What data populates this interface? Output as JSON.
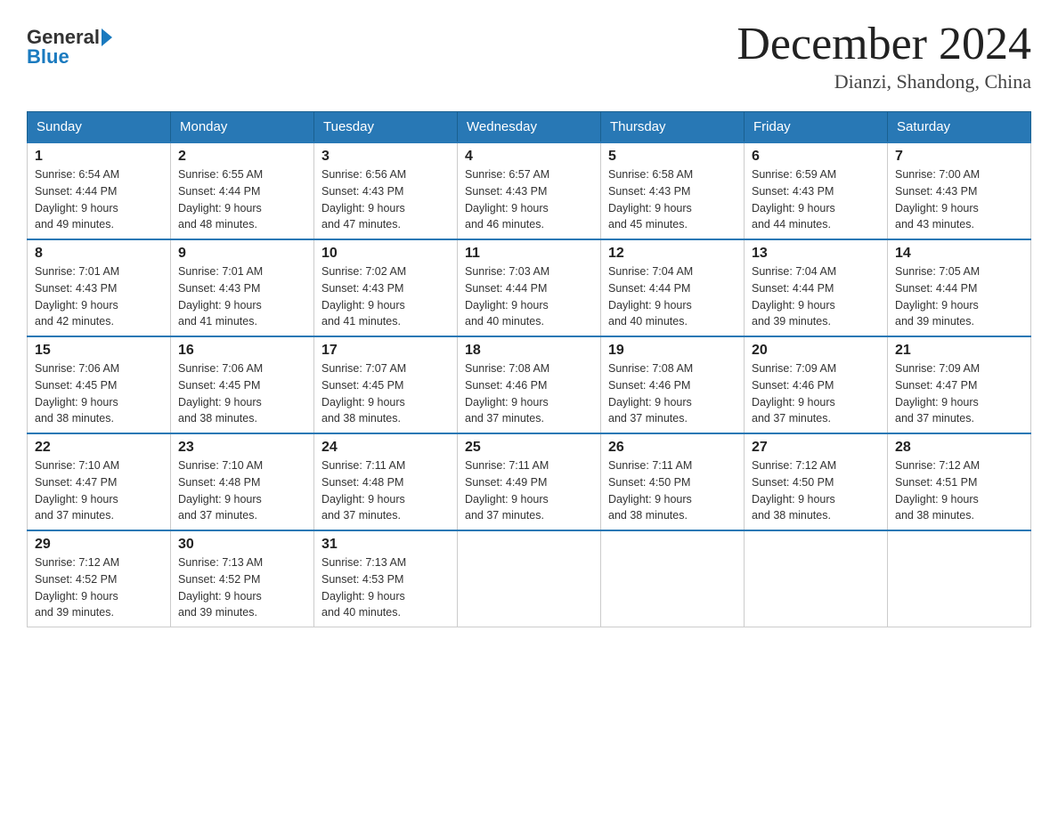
{
  "header": {
    "logo_text_general": "General",
    "logo_text_blue": "Blue",
    "month_title": "December 2024",
    "location": "Dianzi, Shandong, China"
  },
  "weekdays": [
    "Sunday",
    "Monday",
    "Tuesday",
    "Wednesday",
    "Thursday",
    "Friday",
    "Saturday"
  ],
  "weeks": [
    [
      {
        "day": "1",
        "sunrise": "6:54 AM",
        "sunset": "4:44 PM",
        "daylight": "9 hours and 49 minutes."
      },
      {
        "day": "2",
        "sunrise": "6:55 AM",
        "sunset": "4:44 PM",
        "daylight": "9 hours and 48 minutes."
      },
      {
        "day": "3",
        "sunrise": "6:56 AM",
        "sunset": "4:43 PM",
        "daylight": "9 hours and 47 minutes."
      },
      {
        "day": "4",
        "sunrise": "6:57 AM",
        "sunset": "4:43 PM",
        "daylight": "9 hours and 46 minutes."
      },
      {
        "day": "5",
        "sunrise": "6:58 AM",
        "sunset": "4:43 PM",
        "daylight": "9 hours and 45 minutes."
      },
      {
        "day": "6",
        "sunrise": "6:59 AM",
        "sunset": "4:43 PM",
        "daylight": "9 hours and 44 minutes."
      },
      {
        "day": "7",
        "sunrise": "7:00 AM",
        "sunset": "4:43 PM",
        "daylight": "9 hours and 43 minutes."
      }
    ],
    [
      {
        "day": "8",
        "sunrise": "7:01 AM",
        "sunset": "4:43 PM",
        "daylight": "9 hours and 42 minutes."
      },
      {
        "day": "9",
        "sunrise": "7:01 AM",
        "sunset": "4:43 PM",
        "daylight": "9 hours and 41 minutes."
      },
      {
        "day": "10",
        "sunrise": "7:02 AM",
        "sunset": "4:43 PM",
        "daylight": "9 hours and 41 minutes."
      },
      {
        "day": "11",
        "sunrise": "7:03 AM",
        "sunset": "4:44 PM",
        "daylight": "9 hours and 40 minutes."
      },
      {
        "day": "12",
        "sunrise": "7:04 AM",
        "sunset": "4:44 PM",
        "daylight": "9 hours and 40 minutes."
      },
      {
        "day": "13",
        "sunrise": "7:04 AM",
        "sunset": "4:44 PM",
        "daylight": "9 hours and 39 minutes."
      },
      {
        "day": "14",
        "sunrise": "7:05 AM",
        "sunset": "4:44 PM",
        "daylight": "9 hours and 39 minutes."
      }
    ],
    [
      {
        "day": "15",
        "sunrise": "7:06 AM",
        "sunset": "4:45 PM",
        "daylight": "9 hours and 38 minutes."
      },
      {
        "day": "16",
        "sunrise": "7:06 AM",
        "sunset": "4:45 PM",
        "daylight": "9 hours and 38 minutes."
      },
      {
        "day": "17",
        "sunrise": "7:07 AM",
        "sunset": "4:45 PM",
        "daylight": "9 hours and 38 minutes."
      },
      {
        "day": "18",
        "sunrise": "7:08 AM",
        "sunset": "4:46 PM",
        "daylight": "9 hours and 37 minutes."
      },
      {
        "day": "19",
        "sunrise": "7:08 AM",
        "sunset": "4:46 PM",
        "daylight": "9 hours and 37 minutes."
      },
      {
        "day": "20",
        "sunrise": "7:09 AM",
        "sunset": "4:46 PM",
        "daylight": "9 hours and 37 minutes."
      },
      {
        "day": "21",
        "sunrise": "7:09 AM",
        "sunset": "4:47 PM",
        "daylight": "9 hours and 37 minutes."
      }
    ],
    [
      {
        "day": "22",
        "sunrise": "7:10 AM",
        "sunset": "4:47 PM",
        "daylight": "9 hours and 37 minutes."
      },
      {
        "day": "23",
        "sunrise": "7:10 AM",
        "sunset": "4:48 PM",
        "daylight": "9 hours and 37 minutes."
      },
      {
        "day": "24",
        "sunrise": "7:11 AM",
        "sunset": "4:48 PM",
        "daylight": "9 hours and 37 minutes."
      },
      {
        "day": "25",
        "sunrise": "7:11 AM",
        "sunset": "4:49 PM",
        "daylight": "9 hours and 37 minutes."
      },
      {
        "day": "26",
        "sunrise": "7:11 AM",
        "sunset": "4:50 PM",
        "daylight": "9 hours and 38 minutes."
      },
      {
        "day": "27",
        "sunrise": "7:12 AM",
        "sunset": "4:50 PM",
        "daylight": "9 hours and 38 minutes."
      },
      {
        "day": "28",
        "sunrise": "7:12 AM",
        "sunset": "4:51 PM",
        "daylight": "9 hours and 38 minutes."
      }
    ],
    [
      {
        "day": "29",
        "sunrise": "7:12 AM",
        "sunset": "4:52 PM",
        "daylight": "9 hours and 39 minutes."
      },
      {
        "day": "30",
        "sunrise": "7:13 AM",
        "sunset": "4:52 PM",
        "daylight": "9 hours and 39 minutes."
      },
      {
        "day": "31",
        "sunrise": "7:13 AM",
        "sunset": "4:53 PM",
        "daylight": "9 hours and 40 minutes."
      },
      null,
      null,
      null,
      null
    ]
  ],
  "labels": {
    "sunrise": "Sunrise:",
    "sunset": "Sunset:",
    "daylight": "Daylight:"
  }
}
